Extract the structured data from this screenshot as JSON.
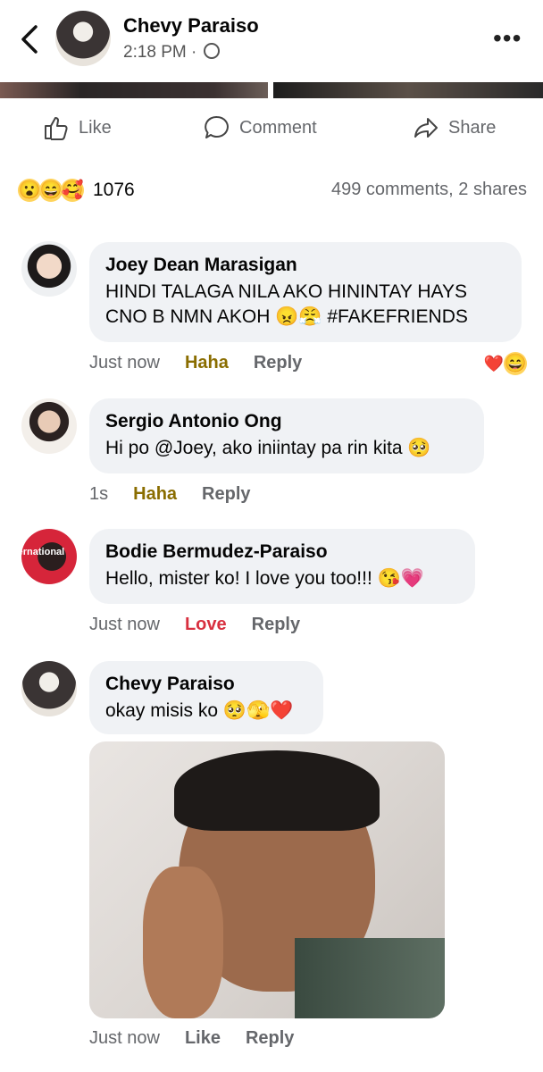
{
  "header": {
    "author": "Chevy Paraiso",
    "time": "2:18 PM ·"
  },
  "actions": {
    "like": "Like",
    "comment": "Comment",
    "share": "Share"
  },
  "stats": {
    "reaction_count": "1076",
    "comments_shares": "499 comments, 2 shares",
    "reaction_emojis": [
      "😮",
      "😄",
      "🥰"
    ]
  },
  "comments": [
    {
      "author": "Joey Dean Marasigan",
      "text_line1": "HINDI TALAGA NILA AKO HININTAY HAYS",
      "text_line2": "CNO B NMN AKOH 😠😤 #FAKEFRIENDS",
      "time": "Just now",
      "my_reaction": "Haha",
      "reply": "Reply",
      "reactions": [
        "❤️",
        "😄"
      ]
    },
    {
      "author": "Sergio Antonio Ong",
      "text": "Hi po @Joey, ako iniintay pa rin kita 🥺",
      "time": "1s",
      "my_reaction": "Haha",
      "reply": "Reply"
    },
    {
      "author": "Bodie Bermudez-Paraiso",
      "text": "Hello, mister ko! I love you too!!! 😘💗",
      "time": "Just now",
      "my_reaction": "Love",
      "reply": "Reply",
      "avatar_text": "ternational"
    },
    {
      "author": "Chevy Paraiso",
      "text": "okay misis ko 🥺🫣❤️",
      "time": "Just now",
      "my_reaction": "Like",
      "reply": "Reply"
    }
  ],
  "colors": {
    "bubble": "#f0f2f5",
    "secondary_text": "#65676b",
    "haha": "#8a6d00",
    "love": "#d8303f"
  }
}
